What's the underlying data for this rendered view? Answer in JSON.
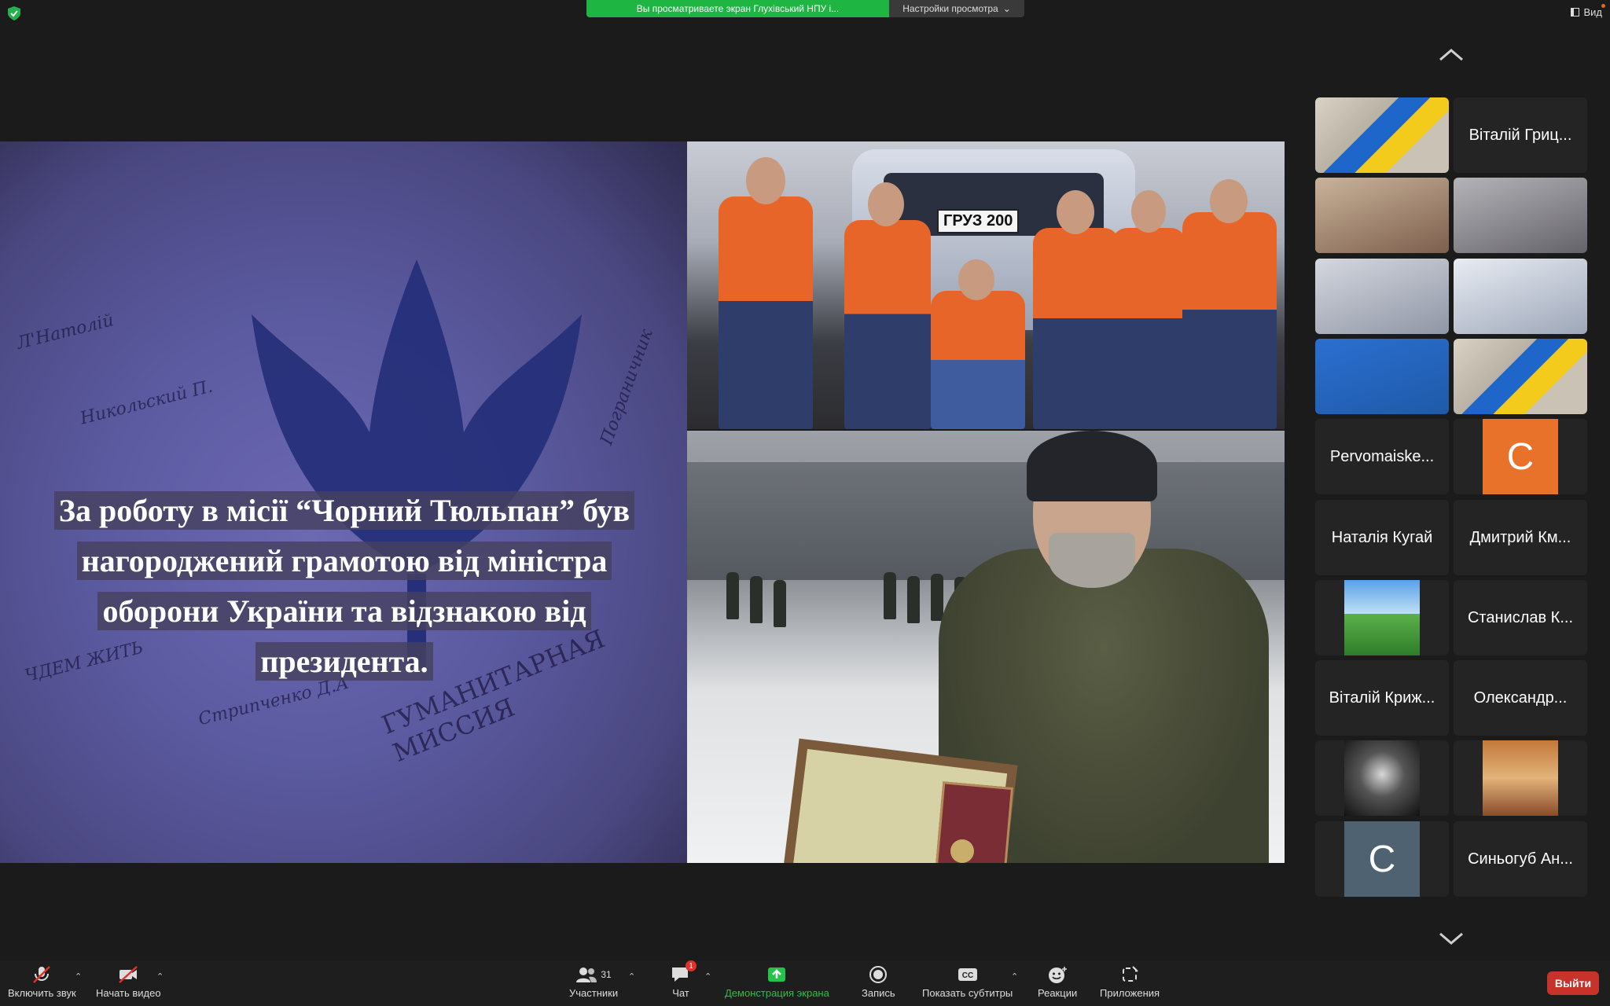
{
  "top_bar": {
    "share_notice": "Вы просматриваете экран Глухівський НПУ і...",
    "view_options": "Настройки просмотра",
    "view_label": "Вид"
  },
  "shared_screen": {
    "caption_lines": [
      "За роботу в місії “Чорний Тюльпан” був",
      "нагороджений грамотою від міністра",
      "оборони України та відзнакою від",
      "президента."
    ],
    "van_plate": "ГРУЗ 200"
  },
  "gallery": {
    "tiles": [
      {
        "name": "",
        "type": "video"
      },
      {
        "name": "Віталій Гриц...",
        "type": "name"
      },
      {
        "name": "",
        "type": "video",
        "active": true
      },
      {
        "name": "",
        "type": "video"
      },
      {
        "name": "",
        "type": "video"
      },
      {
        "name": "",
        "type": "video"
      },
      {
        "name": "",
        "type": "video"
      },
      {
        "name": "",
        "type": "video"
      },
      {
        "name": "Pervomaiske...",
        "type": "name"
      },
      {
        "name": "C",
        "type": "letter",
        "color": "#e8722a"
      },
      {
        "name": "Наталія Кугай",
        "type": "name"
      },
      {
        "name": "Дмитрий Км...",
        "type": "name"
      },
      {
        "name": "",
        "type": "image"
      },
      {
        "name": "Станислав К...",
        "type": "name"
      },
      {
        "name": "Віталій Криж...",
        "type": "name"
      },
      {
        "name": "Олександр...",
        "type": "name"
      },
      {
        "name": "",
        "type": "image"
      },
      {
        "name": "",
        "type": "image"
      },
      {
        "name": "C",
        "type": "letter",
        "color": "#4f6272"
      },
      {
        "name": "Синьогуб Ан...",
        "type": "name"
      }
    ]
  },
  "toolbar": {
    "mute": "Включить звук",
    "video": "Начать видео",
    "participants": "Участники",
    "participants_count": "31",
    "chat": "Чат",
    "chat_badge": "1",
    "share": "Демонстрация экрана",
    "record": "Запись",
    "subtitles": "Показать субтитры",
    "reactions": "Реакции",
    "apps": "Приложения",
    "leave": "Выйти"
  },
  "colors": {
    "share_green": "#1fb543",
    "leave_red": "#c7332b",
    "active_border": "#2ad04b"
  }
}
